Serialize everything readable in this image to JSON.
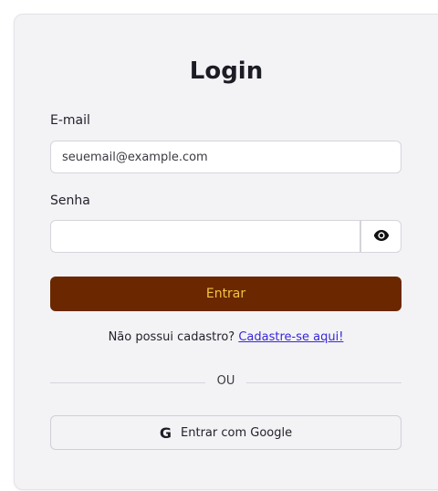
{
  "login": {
    "title": "Login",
    "email_label": "E-mail",
    "email_placeholder": "seuemail@example.com",
    "email_value": "",
    "password_label": "Senha",
    "password_value": "",
    "toggle_visibility_icon": "eye-icon",
    "submit_label": "Entrar",
    "signup_prompt": "Não possui cadastro?",
    "signup_link": "Cadastre-se aqui!",
    "divider_text": "OU",
    "google_icon": "google-icon",
    "google_glyph": "G",
    "google_label": "Entrar com Google"
  },
  "colors": {
    "card_background": "#f3f3f6",
    "primary_button": "#6b2700",
    "primary_button_text": "#f3c542",
    "link": "#3a26d8"
  }
}
